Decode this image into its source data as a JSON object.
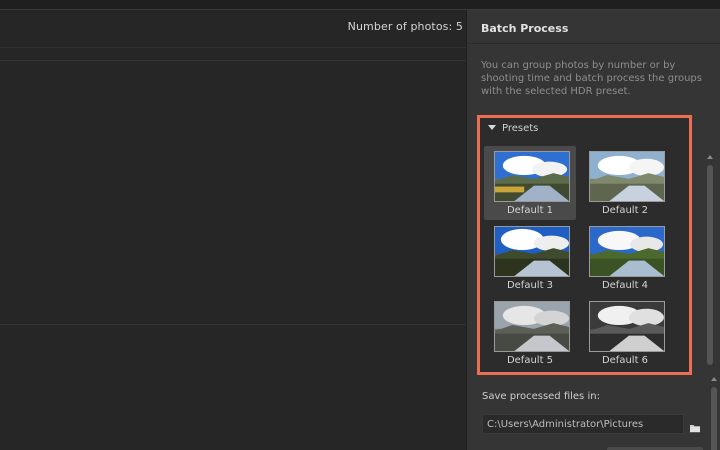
{
  "main": {
    "photo_count": "Number of photos: 5"
  },
  "panel": {
    "title": "Batch Process",
    "description": "You can group photos by number or by shooting time and batch process the groups with the selected HDR preset.",
    "presets": {
      "title": "Presets",
      "selected": "Default 1",
      "items": [
        {
          "label": "Default 1",
          "style": "color"
        },
        {
          "label": "Default 2",
          "style": "bright"
        },
        {
          "label": "Default 3",
          "style": "vivid"
        },
        {
          "label": "Default 4",
          "style": "green"
        },
        {
          "label": "Default 5",
          "style": "muted"
        },
        {
          "label": "Default 6",
          "style": "mono"
        }
      ]
    },
    "save": {
      "label": "Save processed files in:",
      "path": "C:\\Users\\Administrator\\Pictures"
    }
  },
  "colors": {
    "highlight_border": "#ea6f55",
    "panel_bg": "#353535",
    "main_bg": "#262626"
  },
  "icons": {
    "collapse": "triangle-down-icon",
    "folder": "folder-icon"
  }
}
